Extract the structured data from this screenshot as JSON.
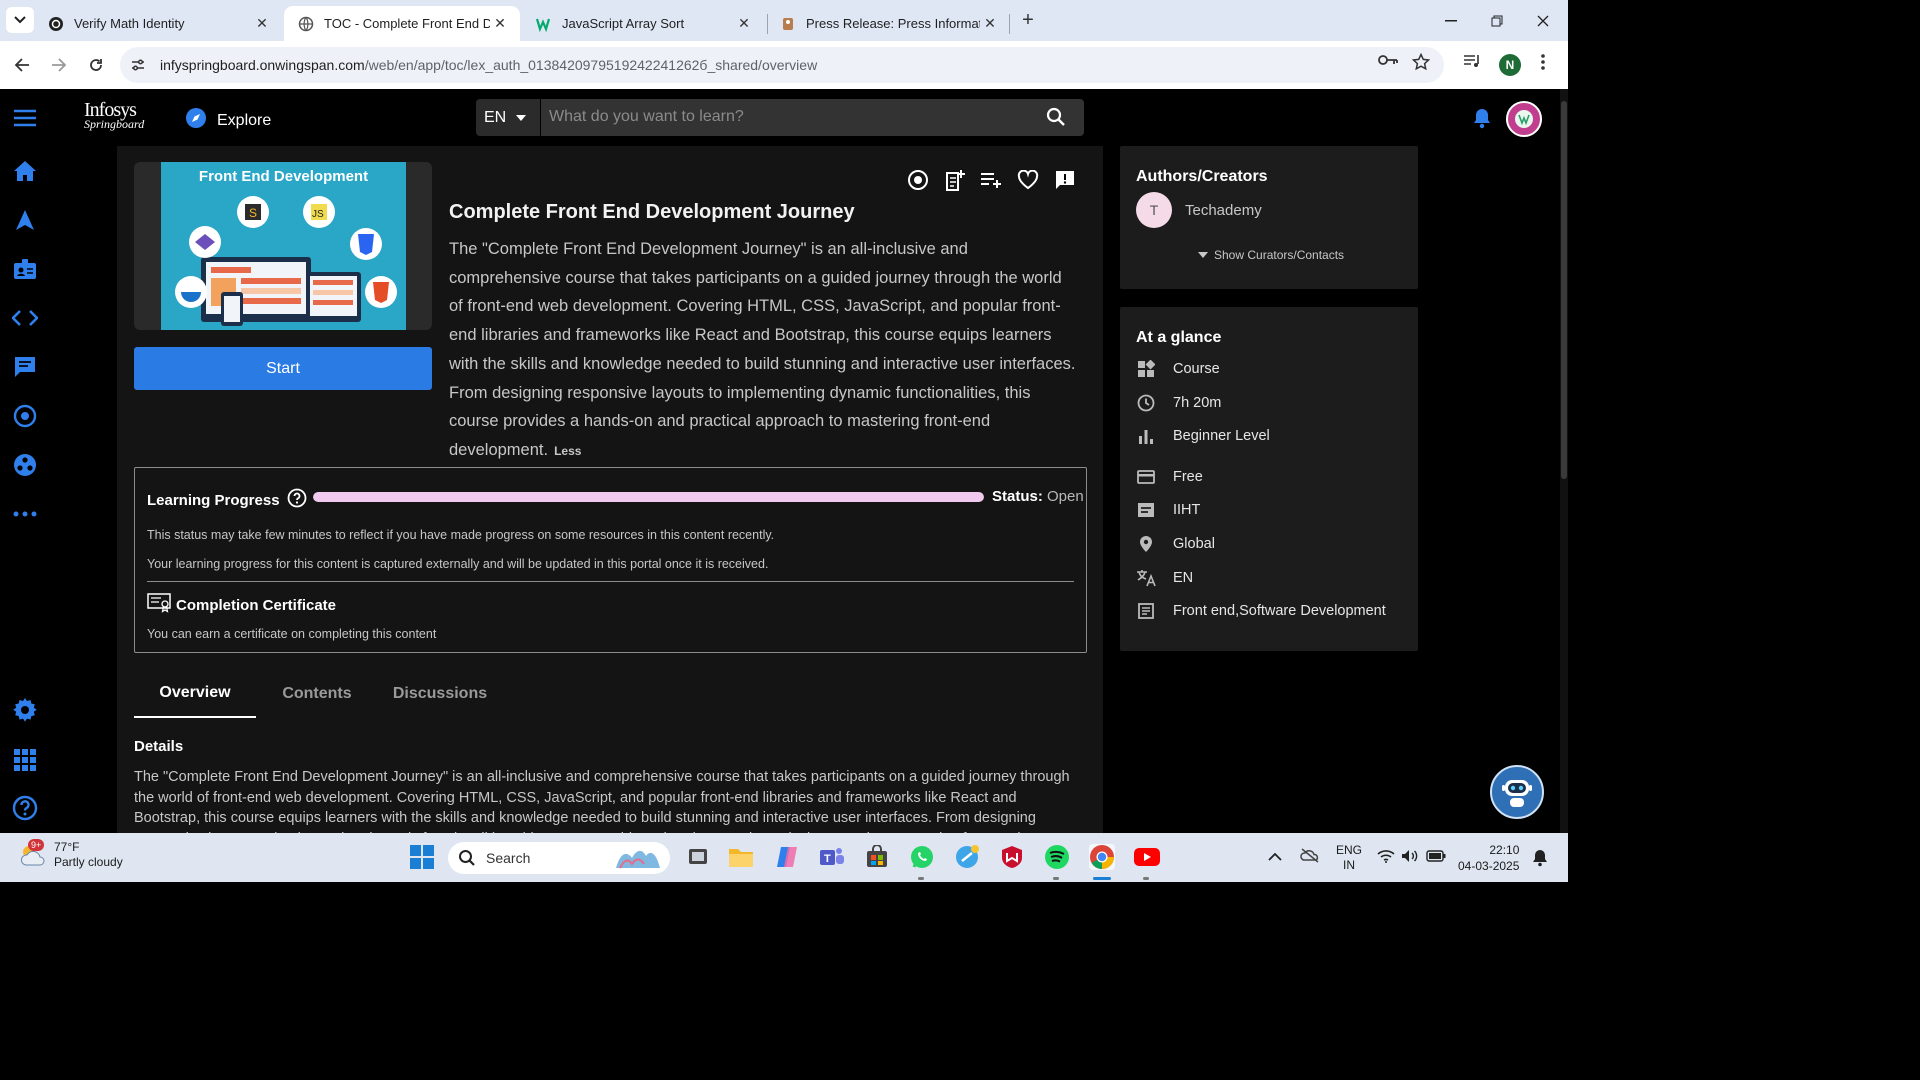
{
  "browser": {
    "tabs": [
      {
        "title": "Verify Math Identity",
        "active": false
      },
      {
        "title": "TOC - Complete Front End Development Journey",
        "active": true
      },
      {
        "title": "JavaScript Array Sort",
        "active": false
      },
      {
        "title": "Press Release: Press Information",
        "active": false
      }
    ],
    "url_host": "infyspringboard.onwingspan.com",
    "url_path": "/web/en/app/toc/lex_auth_0138420979519242241262б_shared/overview",
    "profile_initial": "N"
  },
  "header": {
    "logo_line1": "Infosys",
    "logo_line2": "Springboard",
    "explore_label": "Explore",
    "language": "EN",
    "search_placeholder": "What do you want to learn?"
  },
  "course": {
    "thumbnail_title": "Front End Development",
    "start_label": "Start",
    "title": "Complete Front End Development Journey",
    "description": "The \"Complete Front End Development Journey\" is an all-inclusive and comprehensive course that takes participants on a guided journey through the world of front-end web development. Covering HTML, CSS, JavaScript, and popular front-end libraries and frameworks like React and Bootstrap, this course equips learners with the skills and knowledge needed to build stunning and interactive user interfaces. From designing responsive layouts to implementing dynamic functionalities, this course provides a hands-on and practical approach to mastering front-end development.",
    "less_label": "Less"
  },
  "progress": {
    "title": "Learning Progress",
    "status_label": "Status:",
    "status_value": "Open",
    "progress_fraction": 1.0,
    "note1": "This status may take few minutes to reflect if you have made progress on some resources in this content recently.",
    "note2": "Your learning progress for this content is captured externally and will be updated in this portal once it is received.",
    "cert_title": "Completion Certificate",
    "cert_note": "You can earn a certificate on completing this content"
  },
  "content_tabs": [
    {
      "label": "Overview",
      "active": true
    },
    {
      "label": "Contents",
      "active": false
    },
    {
      "label": "Discussions",
      "active": false
    }
  ],
  "details": {
    "heading": "Details",
    "text": "The \"Complete Front End Development Journey\" is an all-inclusive and comprehensive course that takes participants on a guided journey through the world of front-end web development. Covering HTML, CSS, JavaScript, and popular front-end libraries and frameworks like React and Bootstrap, this course equips learners with the skills and knowledge needed to build stunning and interactive user interfaces. From designing responsive layouts to implementing dynamic functionalities, this course provides a hands-on and practical approach to mastering front-end development."
  },
  "authors": {
    "heading": "Authors/Creators",
    "initial": "T",
    "name": "Techademy",
    "show_curators": "Show Curators/Contacts"
  },
  "glance": {
    "heading": "At a glance",
    "items": [
      {
        "icon": "content-type-icon",
        "text": "Course"
      },
      {
        "icon": "clock-icon",
        "text": "7h 20m"
      },
      {
        "icon": "level-icon",
        "text": "Beginner Level"
      },
      {
        "icon": "card-icon",
        "text": "Free"
      },
      {
        "icon": "provider-icon",
        "text": "IIHT"
      },
      {
        "icon": "location-icon",
        "text": "Global"
      },
      {
        "icon": "translate-icon",
        "text": "EN"
      },
      {
        "icon": "subject-icon",
        "text": "Front end,Software Development"
      }
    ]
  },
  "taskbar": {
    "weather_badge": "9+",
    "temperature": "77°F",
    "condition": "Partly cloudy",
    "search_label": "Search",
    "lang_line1": "ENG",
    "lang_line2": "IN",
    "time": "22:10",
    "date": "04-03-2025"
  },
  "colors": {
    "accent": "#2b7be5",
    "progress_fill": "#f2c9ef",
    "nav_icon": "#2f80ed"
  }
}
